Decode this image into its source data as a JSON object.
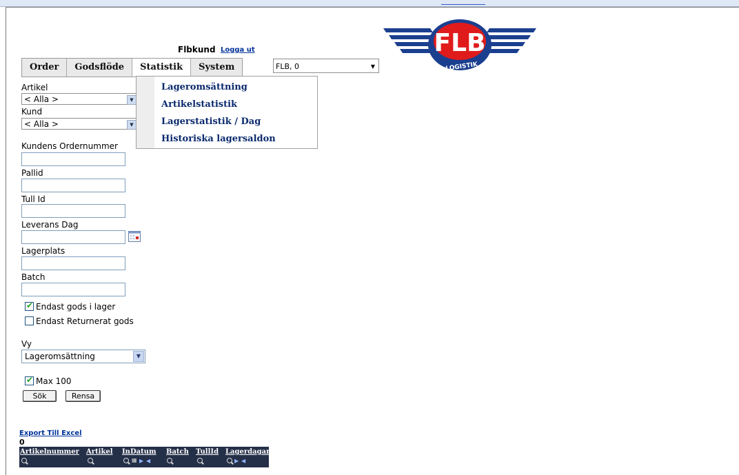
{
  "header": {
    "user": "Flbkund",
    "logout": "Logga ut"
  },
  "menu": {
    "items": [
      "Order",
      "Godsflöde",
      "Statistik",
      "System"
    ],
    "active": "Statistik"
  },
  "client_select": {
    "value": "FLB, 0"
  },
  "logo": {
    "text": "FLB",
    "subtext": "LOGISTIK"
  },
  "dropdown": {
    "items": [
      "Lageromsättning",
      "Artikelstatistik",
      "Lagerstatistik / Dag",
      "Historiska lagersaldon"
    ]
  },
  "form": {
    "artikel_label": "Artikel",
    "artikel_value": "< Alla >",
    "kund_label": "Kund",
    "kund_value": "< Alla >",
    "ordernummer_label": "Kundens Ordernummer",
    "pallid_label": "Pallid",
    "tullid_label": "Tull Id",
    "leverans_label": "Leverans Dag",
    "lagerplats_label": "Lagerplats",
    "batch_label": "Batch",
    "endast_lager_label": "Endast gods i lager",
    "endast_lager_checked": true,
    "endast_retur_label": "Endast Returnerat gods",
    "endast_retur_checked": false,
    "vy_label": "Vy",
    "vy_value": "Lageromsättning",
    "max100_label": "Max 100",
    "max100_checked": true,
    "search_button": "Sök",
    "clear_button": "Rensa"
  },
  "results": {
    "export_link": "Export Till Excel",
    "count": "0",
    "columns": [
      "Artikelnummer",
      "Artikel",
      "InDatum",
      "Batch",
      "TullId",
      "Lagerdagar"
    ]
  }
}
